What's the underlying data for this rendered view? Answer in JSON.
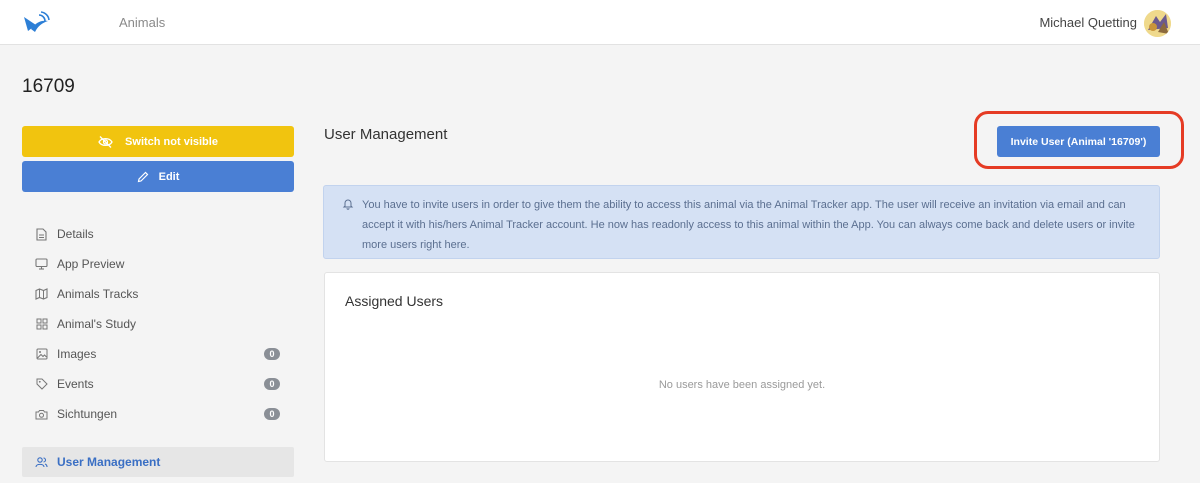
{
  "header": {
    "nav_animals": "Animals",
    "user_name": "Michael Quetting"
  },
  "page": {
    "title": "16709"
  },
  "actions": {
    "switch_label": "Switch not visible",
    "edit_label": "Edit"
  },
  "sidebar": {
    "items": [
      {
        "label": "Details",
        "icon": "document-icon"
      },
      {
        "label": "App Preview",
        "icon": "monitor-icon"
      },
      {
        "label": "Animals Tracks",
        "icon": "map-icon"
      },
      {
        "label": "Animal's Study",
        "icon": "grid-icon"
      },
      {
        "label": "Images",
        "icon": "image-icon",
        "badge": "0"
      },
      {
        "label": "Events",
        "icon": "tag-icon",
        "badge": "0"
      },
      {
        "label": "Sichtungen",
        "icon": "camera-icon",
        "badge": "0"
      },
      {
        "label": "User Management",
        "icon": "users-icon"
      }
    ]
  },
  "main": {
    "section_title": "User Management",
    "invite_button": "Invite User (Animal '16709')",
    "info_text": "You have to invite users in order to give them the ability to access this animal via the Animal Tracker app. The user will receive an invitation via email and can accept it with his/hers Animal Tracker account. He now has readonly access to this animal within the App. You can always come back and delete users or invite more users right here.",
    "assigned_title": "Assigned Users",
    "empty_message": "No users have been assigned yet."
  },
  "colors": {
    "accent_blue": "#4a7fd4",
    "warning_yellow": "#f1c40f",
    "highlight_red": "#e53b24",
    "info_bg": "#d5e1f4"
  }
}
